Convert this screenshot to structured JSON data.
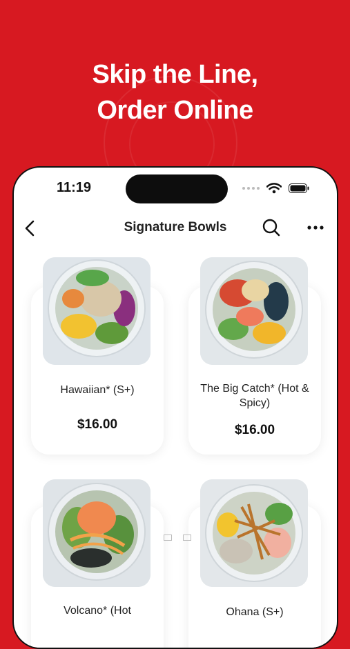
{
  "headline": {
    "line1": "Skip the Line,",
    "line2": "Order Online"
  },
  "status_bar": {
    "time": "11:19"
  },
  "nav": {
    "title": "Signature Bowls"
  },
  "products": [
    {
      "name": "Hawaiian* (S+)",
      "price": "$16.00"
    },
    {
      "name": "The Big Catch* (Hot & Spicy)",
      "price": "$16.00"
    },
    {
      "name": "Volcano* (Hot",
      "price": ""
    },
    {
      "name": "Ohana (S+)",
      "price": ""
    }
  ],
  "colors": {
    "brand_red": "#d71921",
    "background": "#ffffff"
  },
  "icons": [
    "back-arrow-icon",
    "search-icon",
    "more-icon",
    "wifi-icon",
    "battery-icon"
  ]
}
